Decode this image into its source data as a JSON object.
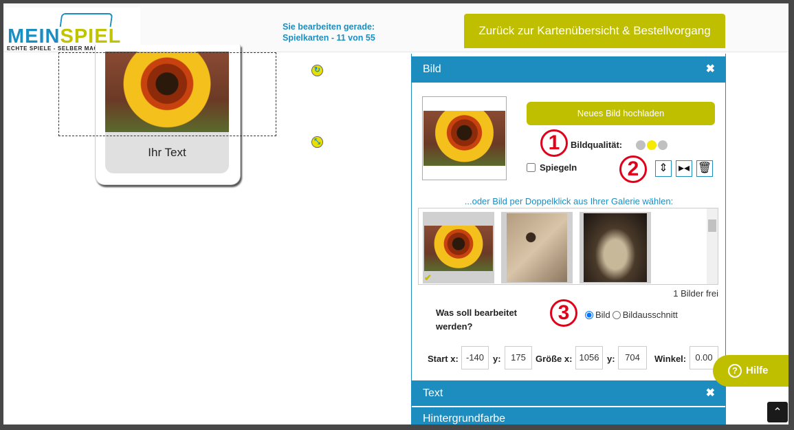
{
  "header": {
    "logo_main_a": "MEIN",
    "logo_main_b": "SPIEL",
    "logo_sub": "ECHTE SPIELE - SELBER MACHEN",
    "editing_line1": "Sie bearbeiten gerade:",
    "editing_line2": "Spielkarten - 11 von 55",
    "back_button": "Zurück zur Kartenübersicht & Bestellvorgang"
  },
  "card": {
    "text": "Ihr Text"
  },
  "panel": {
    "bild": {
      "title": "Bild",
      "close_icon": "close-icon",
      "upload_button": "Neues Bild hochladen",
      "quality_label": "Bildqualität:",
      "quality_level": 2,
      "quality_max": 3,
      "mirror_label": "Spiegeln",
      "mirror_checked": false,
      "annotation_1": "1",
      "annotation_2": "2",
      "annotation_3": "3",
      "gallery_label": "...oder Bild per Doppelklick aus Ihrer Galerie wählen:",
      "free_count": "1 Bilder frei",
      "edit_question": "Was soll bearbeitet werden?",
      "radio_options": [
        "Bild",
        "Bildausschnitt"
      ],
      "radio_selected": "Bild",
      "start_x_label": "Start x:",
      "start_x": "-140",
      "start_y_label": "y:",
      "start_y": "175",
      "size_x_label": "Größe x:",
      "size_x": "1056",
      "size_y_label": "y:",
      "size_y": "704",
      "angle_label": "Winkel:",
      "angle": "0.00"
    },
    "text_section": "Text",
    "background_section": "Hintergrundfarbe"
  },
  "help_button": "Hilfe",
  "colors": {
    "accent_blue": "#1d8dbf",
    "accent_green": "#bfbf00",
    "annotation_red": "#e0001a"
  }
}
